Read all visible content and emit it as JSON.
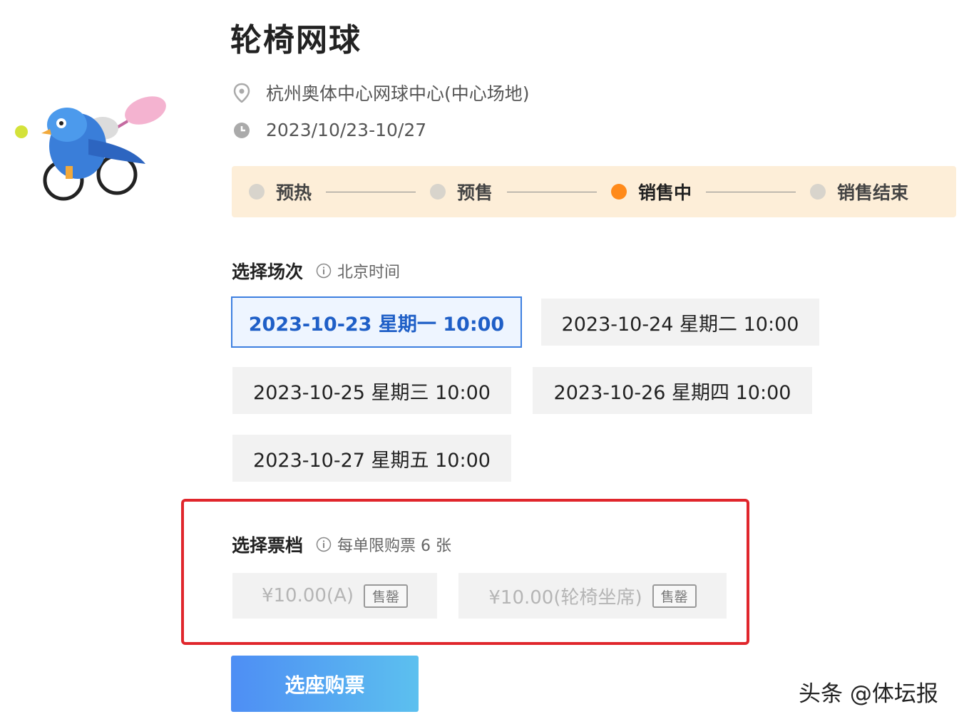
{
  "event": {
    "title": "轮椅网球",
    "venue": "杭州奥体中心网球中心(中心场地)",
    "date_range": "2023/10/23-10/27"
  },
  "status_steps": [
    {
      "label": "预热",
      "active": false
    },
    {
      "label": "预售",
      "active": false
    },
    {
      "label": "销售中",
      "active": true
    },
    {
      "label": "销售结束",
      "active": false
    }
  ],
  "session_section": {
    "title": "选择场次",
    "hint": "北京时间"
  },
  "sessions": [
    {
      "label": "2023-10-23 星期一 10:00",
      "selected": true
    },
    {
      "label": "2023-10-24 星期二 10:00",
      "selected": false
    },
    {
      "label": "2023-10-25 星期三 10:00",
      "selected": false
    },
    {
      "label": "2023-10-26 星期四 10:00",
      "selected": false
    },
    {
      "label": "2023-10-27 星期五 10:00",
      "selected": false
    }
  ],
  "ticket_section": {
    "title": "选择票档",
    "hint": "每单限购票 6 张"
  },
  "tickets": [
    {
      "price_label": "¥10.00(A)",
      "status": "售罄"
    },
    {
      "price_label": "¥10.00(轮椅坐席)",
      "status": "售罄"
    }
  ],
  "buy_button": "选座购票",
  "watermark": "头条 @体坛报",
  "colors": {
    "accent_blue": "#3d7fe0",
    "active_step": "#ff8a1a",
    "status_bar_bg": "#fdeed8",
    "highlight_border": "#e0262c"
  },
  "icons": {
    "venue": "location-pin-icon",
    "date": "clock-icon",
    "hint": "info-circle-icon"
  }
}
